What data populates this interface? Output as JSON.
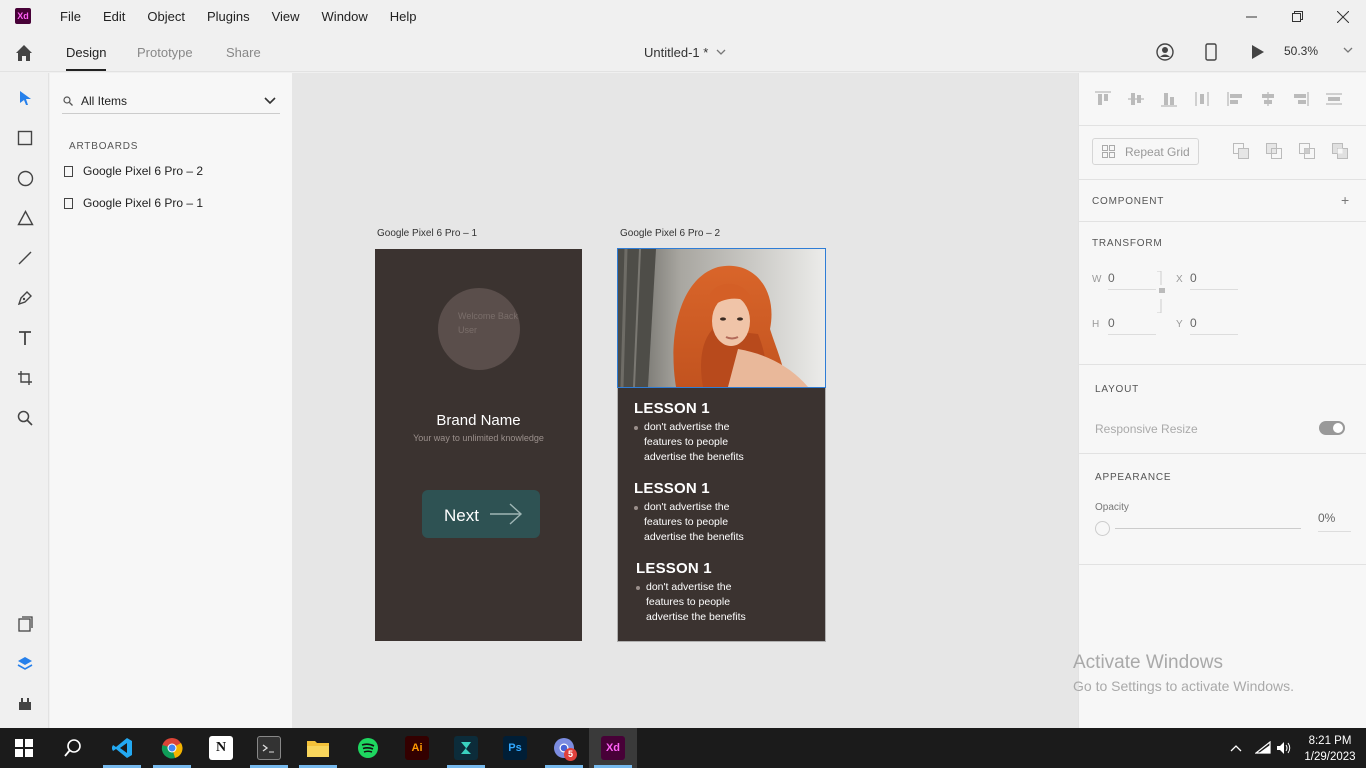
{
  "app": {
    "logo_text": "Xd"
  },
  "menu": [
    "File",
    "Edit",
    "Object",
    "Plugins",
    "View",
    "Window",
    "Help"
  ],
  "tabs": {
    "design": "Design",
    "prototype": "Prototype",
    "share": "Share"
  },
  "document": {
    "title": "Untitled-1 *"
  },
  "zoom": "50.3%",
  "layers": {
    "search_label": "All Items",
    "section": "ARTBOARDS",
    "items": [
      "Google Pixel 6 Pro – 2",
      "Google Pixel 6 Pro – 1"
    ]
  },
  "canvas": {
    "artboard1": {
      "label": "Google Pixel 6 Pro – 1",
      "avatar_text": "Welcome Back User",
      "brand": "Brand Name",
      "tagline": "Your way to unlimited knowledge",
      "button": "Next"
    },
    "artboard2": {
      "label": "Google Pixel 6 Pro – 2",
      "lessons": [
        {
          "title": "LESSON 1",
          "lines": [
            "don't advertise the",
            "features to people",
            "advertise the benefits"
          ]
        },
        {
          "title": "LESSON 1",
          "lines": [
            "don't advertise the",
            "features to people",
            "advertise the benefits"
          ]
        },
        {
          "title": "LESSON 1",
          "lines": [
            "don't advertise the",
            "features to people",
            "advertise the benefits"
          ]
        }
      ]
    }
  },
  "properties": {
    "repeat_grid": "Repeat Grid",
    "component": "COMPONENT",
    "transform": "TRANSFORM",
    "w_label": "W",
    "w_value": "0",
    "x_label": "X",
    "x_value": "0",
    "h_label": "H",
    "h_value": "0",
    "y_label": "Y",
    "y_value": "0",
    "layout": "LAYOUT",
    "responsive_resize": "Responsive Resize",
    "appearance": "APPEARANCE",
    "opacity_label": "Opacity",
    "opacity_value": "0%"
  },
  "watermark": {
    "title": "Activate Windows",
    "subtitle": "Go to Settings to activate Windows."
  },
  "taskbar": {
    "time": "8:21 PM",
    "date": "1/29/2023",
    "badge": "5"
  },
  "colors": {
    "artboard_bg": "#3b3330",
    "button_bg": "#2e5253",
    "selection": "#2f7dd6",
    "accent": "#2680eb"
  }
}
